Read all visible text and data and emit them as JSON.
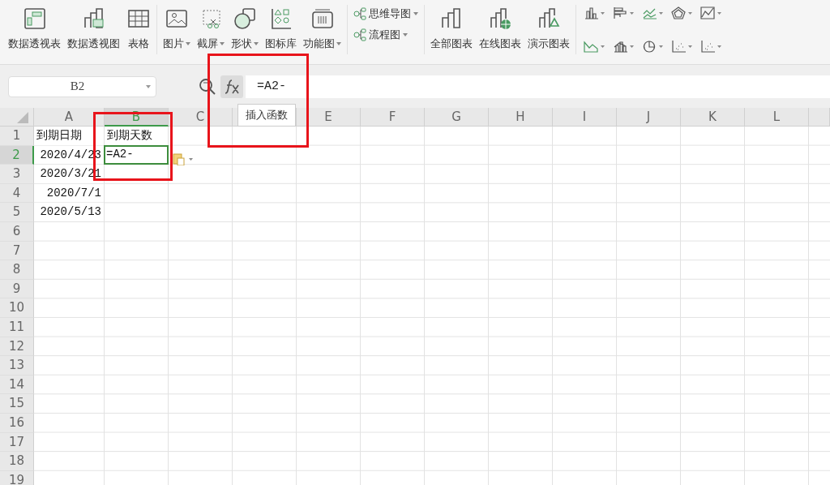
{
  "ribbon": {
    "groups": [
      {
        "kind": "large",
        "buttons": [
          {
            "label": "数据透视表",
            "dropdown": false
          },
          {
            "label": "数据透视图",
            "dropdown": false
          },
          {
            "label": "表格",
            "dropdown": false
          }
        ]
      },
      {
        "kind": "large",
        "buttons": [
          {
            "label": "图片",
            "dropdown": true
          },
          {
            "label": "截屏",
            "dropdown": true
          },
          {
            "label": "形状",
            "dropdown": true
          },
          {
            "label": "图标库",
            "dropdown": false
          },
          {
            "label": "功能图",
            "dropdown": true
          }
        ]
      },
      {
        "kind": "small",
        "buttons": [
          {
            "label": "思维导图",
            "dropdown": true
          },
          {
            "label": "流程图",
            "dropdown": true
          }
        ]
      },
      {
        "kind": "large",
        "buttons": [
          {
            "label": "全部图表",
            "dropdown": false
          },
          {
            "label": "在线图表",
            "dropdown": false
          },
          {
            "label": "演示图表",
            "dropdown": false
          }
        ]
      },
      {
        "kind": "chart_icons"
      }
    ]
  },
  "formula_bar": {
    "name_box": "B2",
    "formula": "=A2-",
    "tooltip": "插入函数"
  },
  "sheet": {
    "columns": [
      {
        "label": "A",
        "selected": false
      },
      {
        "label": "B",
        "selected": true
      },
      {
        "label": "C",
        "selected": false
      },
      {
        "selected": false
      },
      {
        "label": "E",
        "selected": false
      },
      {
        "label": "F",
        "selected": false
      },
      {
        "label": "G",
        "selected": false
      },
      {
        "label": "H",
        "selected": false
      },
      {
        "label": "I",
        "selected": false
      },
      {
        "label": "J",
        "selected": false
      },
      {
        "label": "K",
        "selected": false
      },
      {
        "label": "L",
        "selected": false
      }
    ],
    "rows": [
      {
        "label": "1",
        "selected": false,
        "cells": [
          {
            "text": "到期日期",
            "kind": "text",
            "active": false
          },
          {
            "text": "到期天数",
            "kind": "text",
            "active": false
          }
        ]
      },
      {
        "label": "2",
        "selected": true,
        "cells": [
          {
            "text": "2020/4/23",
            "kind": "number",
            "active": false
          },
          {
            "text": "=A2-",
            "kind": "text",
            "active": true
          }
        ]
      },
      {
        "label": "3",
        "selected": false,
        "cells": [
          {
            "text": "2020/3/21",
            "kind": "number",
            "active": false
          }
        ]
      },
      {
        "label": "4",
        "selected": false,
        "cells": [
          {
            "text": "2020/7/1",
            "kind": "number",
            "active": false
          }
        ]
      },
      {
        "label": "5",
        "selected": false,
        "cells": [
          {
            "text": "2020/5/13",
            "kind": "number",
            "active": false
          }
        ]
      },
      {
        "label": "6",
        "selected": false,
        "cells": []
      },
      {
        "label": "7",
        "selected": false,
        "cells": []
      },
      {
        "label": "8",
        "selected": false,
        "cells": []
      },
      {
        "label": "9",
        "selected": false,
        "cells": []
      },
      {
        "label": "10",
        "selected": false,
        "cells": []
      },
      {
        "label": "11",
        "selected": false,
        "cells": []
      },
      {
        "label": "12",
        "selected": false,
        "cells": []
      },
      {
        "label": "13",
        "selected": false,
        "cells": []
      },
      {
        "label": "14",
        "selected": false,
        "cells": []
      },
      {
        "label": "15",
        "selected": false,
        "cells": []
      },
      {
        "label": "16",
        "selected": false,
        "cells": []
      },
      {
        "label": "17",
        "selected": false,
        "cells": []
      },
      {
        "label": "18",
        "selected": false,
        "cells": []
      },
      {
        "label": "19",
        "selected": false,
        "cells": []
      }
    ]
  }
}
